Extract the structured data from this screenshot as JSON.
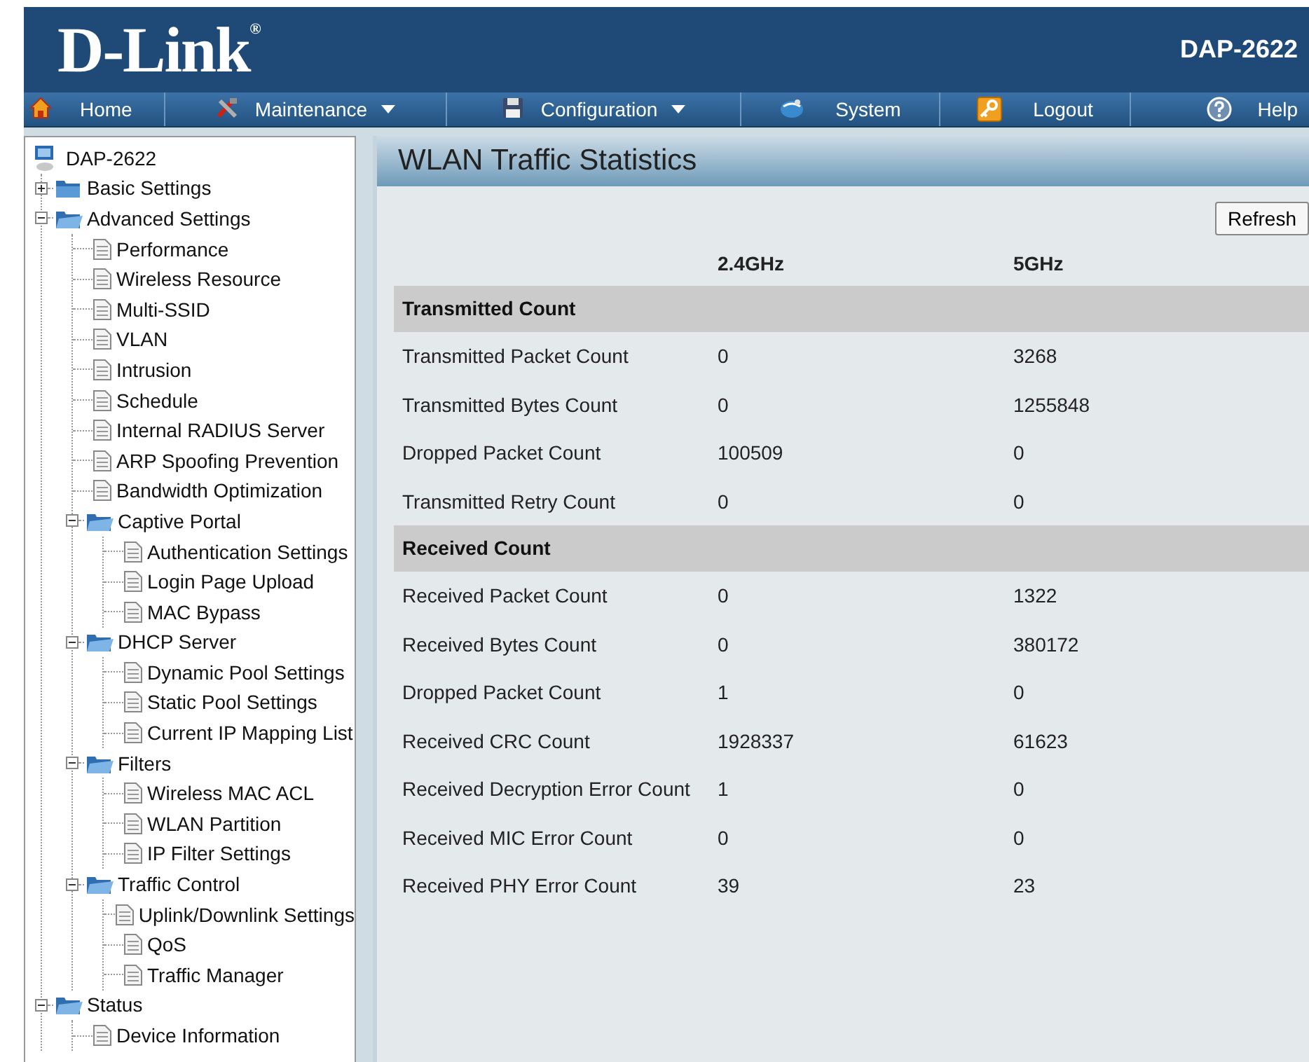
{
  "header": {
    "logo": "D-Link$^{®}$",
    "model": "DAP-2622"
  },
  "nav": [
    {
      "label": "Home",
      "dropdown": false
    },
    {
      "label": "Maintenance",
      "dropdown": true
    },
    {
      "label": "Configuration",
      "dropdown": true
    },
    {
      "label": "System",
      "dropdown": false
    },
    {
      "label": "Logout",
      "dropdown": false
    },
    {
      "label": "Help",
      "dropdown": false
    }
  ],
  "sidebar": {
    "tree": [
      {
        "label": "DAP-2622",
        "kind": "device",
        "children": [
          {
            "label": "Basic Settings",
            "kind": "folder",
            "expanded": false
          },
          {
            "label": "Advanced Settings",
            "kind": "folder",
            "expanded": true,
            "children": [
              {
                "label": "Performance",
                "kind": "page"
              },
              {
                "label": "Wireless Resource",
                "kind": "page"
              },
              {
                "label": "Multi-SSID",
                "kind": "page"
              },
              {
                "label": "VLAN",
                "kind": "page"
              },
              {
                "label": "Intrusion",
                "kind": "page"
              },
              {
                "label": "Schedule",
                "kind": "page"
              },
              {
                "label": "Internal RADIUS Server",
                "kind": "page"
              },
              {
                "label": "ARP Spoofing Prevention",
                "kind": "page"
              },
              {
                "label": "Bandwidth Optimization",
                "kind": "page"
              },
              {
                "label": "Captive Portal",
                "kind": "folder",
                "expanded": true,
                "children": [
                  {
                    "label": "Authentication Settings",
                    "kind": "page"
                  },
                  {
                    "label": "Login Page Upload",
                    "kind": "page"
                  },
                  {
                    "label": "MAC Bypass",
                    "kind": "page"
                  }
                ]
              },
              {
                "label": "DHCP Server",
                "kind": "folder",
                "expanded": true,
                "children": [
                  {
                    "label": "Dynamic Pool Settings",
                    "kind": "page"
                  },
                  {
                    "label": "Static Pool Settings",
                    "kind": "page"
                  },
                  {
                    "label": "Current IP Mapping List",
                    "kind": "page"
                  }
                ]
              },
              {
                "label": "Filters",
                "kind": "folder",
                "expanded": true,
                "children": [
                  {
                    "label": "Wireless MAC ACL",
                    "kind": "page"
                  },
                  {
                    "label": "WLAN Partition",
                    "kind": "page"
                  },
                  {
                    "label": "IP Filter Settings",
                    "kind": "page"
                  }
                ]
              },
              {
                "label": "Traffic Control",
                "kind": "folder",
                "expanded": true,
                "children": [
                  {
                    "label": "Uplink/Downlink Settings",
                    "kind": "page"
                  },
                  {
                    "label": "QoS",
                    "kind": "page"
                  },
                  {
                    "label": "Traffic Manager",
                    "kind": "page"
                  }
                ]
              }
            ]
          },
          {
            "label": "Status",
            "kind": "folder",
            "expanded": true,
            "children": [
              {
                "label": "Device Information",
                "kind": "page"
              }
            ]
          }
        ]
      }
    ]
  },
  "content": {
    "title": "WLAN Traffic Statistics",
    "refresh_button": "Refresh",
    "table": {
      "columns": [
        "2.4GHz",
        "5GHz"
      ],
      "sections": [
        {
          "title": "Transmitted Count",
          "rows": [
            [
              "Transmitted Packet Count",
              "0",
              "3268"
            ],
            [
              "Transmitted Bytes Count",
              "0",
              "1255848"
            ],
            [
              "Dropped Packet Count",
              "100509",
              "0"
            ],
            [
              "Transmitted Retry Count",
              "0",
              "0"
            ]
          ]
        },
        {
          "title": "Received Count",
          "rows": [
            [
              "Received Packet Count",
              "0",
              "1322"
            ],
            [
              "Received Bytes Count",
              "0",
              "380172"
            ],
            [
              "Dropped Packet Count",
              "1",
              "0"
            ],
            [
              "Received CRC Count",
              "1928337",
              "61623"
            ],
            [
              "Received Decryption Error Count",
              "1",
              "0"
            ],
            [
              "Received MIC Error Count",
              "0",
              "0"
            ],
            [
              "Received PHY Error Count",
              "39",
              "23"
            ]
          ]
        }
      ]
    }
  }
}
